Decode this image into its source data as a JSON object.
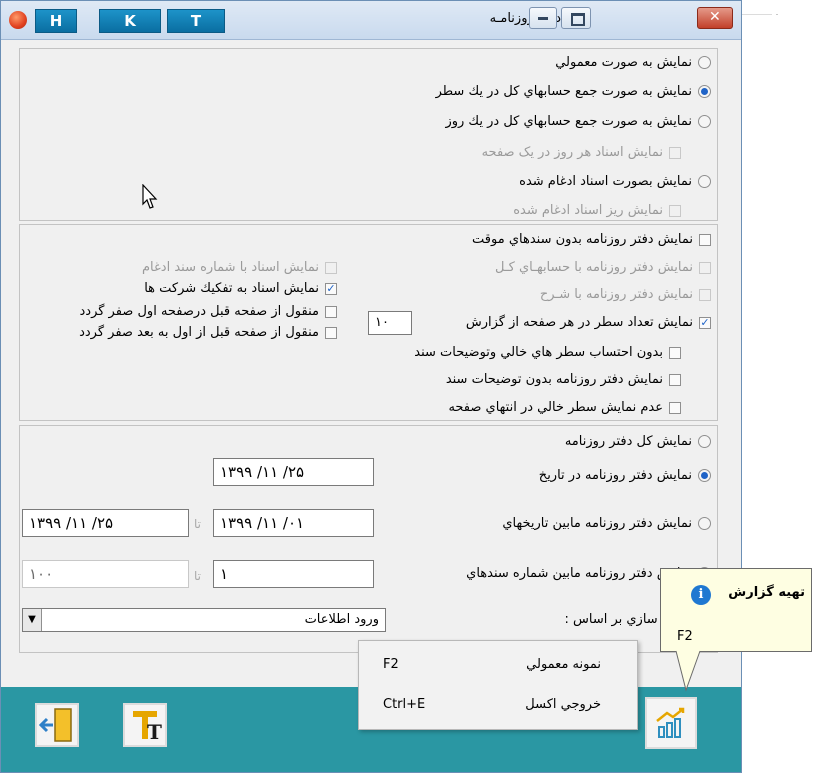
{
  "window": {
    "title": "دفتر روزنامـه",
    "toolbar_buttons": [
      "H",
      "K",
      "T"
    ],
    "controls": [
      "minimize",
      "restore",
      "close"
    ]
  },
  "display_mode": {
    "options": [
      "نمايش به صورت معمولي",
      "نمايش به صورت جمع حسابهاي كل در يك سطر",
      "نمايش به صورت جمع حسابهاي كل در يك روز",
      "نمايش اسناد هر روز در يک صفحه",
      "نمايش بصورت اسناد ادغام شده",
      "نمايش ريز اسناد ادغام شده"
    ],
    "selected": 1
  },
  "options": {
    "right_col": [
      "نمايش دفتر روزنامه بدون سندهاي موقت",
      "نمايش دفتر روزنامه با حسابهـاي كـل",
      "نمايش دفتر روزنامه با شـرح",
      "نمايش تعداد سطر در هر صفحه از گزارش",
      "بدون احتساب سطر هاي خالي وتوضيحات سند",
      "نمايش دفتر روزنامه بدون توضيحات سند",
      "عدم نمايش سطر خالي در انتهاي صفحه"
    ],
    "rows_per_page": "۱۰",
    "left_col": [
      "نمايش اسناد با شماره سند ادغام",
      "نمايش اسناد به تفكيك شركت ها",
      "منقول از صفحه قبل درصفحه اول صفر گردد",
      "منقول از صفحه قبل از اول به بعد صفر گردد"
    ]
  },
  "range": {
    "options": [
      "نمايش كل دفتر روزنامه",
      "نمايش دفتر روزنامه در تاريخ",
      "نمايش دفتر روزنامه مابين تاريخهاي",
      "نمايش دفتر روزنامه مابين شماره سندهاي"
    ],
    "selected": 1,
    "single_date": "۱۳۹۹ /۱۱ /۲۵",
    "from_date": "۱۳۹۹ /۱۱ /۰۱",
    "to_date": "۱۳۹۹ /۱۱ /۲۵",
    "to_label": "تا",
    "from_doc": "۱",
    "to_doc": "۱۰۰",
    "sort_label": "ترتب سازي بر اساس :",
    "sort_value": "ورود اطلاعات"
  },
  "menu": {
    "items": [
      {
        "label": "نمونه معمولي",
        "shortcut": "F2"
      },
      {
        "label": "خروجي اكسل",
        "shortcut": "Ctrl+E"
      }
    ]
  },
  "tooltip": {
    "title": "تهيه گزارش",
    "shortcut": "F2"
  },
  "colors": {
    "bottom_bar": "#2a97a3",
    "accent": "#1f63c7",
    "tooltip_bg": "#fefee2"
  }
}
